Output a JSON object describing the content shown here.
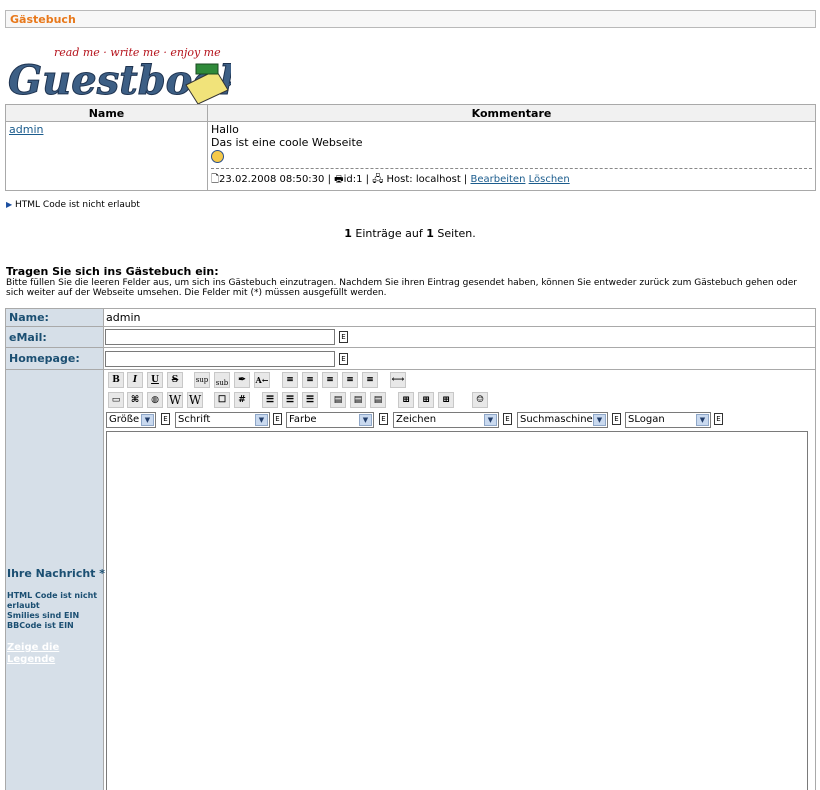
{
  "page_title": "Gästebuch",
  "logo": {
    "tagline": "read me · write me · enjoy me",
    "word": "Guestbook"
  },
  "table": {
    "col_name": "Name",
    "col_comments": "Kommentare",
    "entry": {
      "name": "admin",
      "line1": "Hallo",
      "line2": "Das ist eine coole Webseite",
      "meta_date": "23.02.2008 08:50:30",
      "meta_id": "id:1",
      "meta_host": "Host: localhost",
      "edit_link": "Bearbeiten",
      "delete_link": "Löschen"
    }
  },
  "html_notice": "HTML Code ist nicht erlaubt",
  "pagination": {
    "count": "1",
    "middle": " Einträge auf ",
    "pages": "1",
    "suffix": " Seiten."
  },
  "sign": {
    "title": "Tragen Sie sich ins Gästebuch ein:",
    "text": "Bitte füllen Sie die leeren Felder aus, um sich ins Gästebuch einzutragen. Nachdem Sie ihren Eintrag gesendet haben, können Sie entweder zurück zum Gästebuch gehen oder sich weiter auf der Webseite umsehen. Die Felder mit (*) müssen ausgefüllt werden."
  },
  "form": {
    "name_label": "Name:",
    "name_value": "admin",
    "email_label": "eMail:",
    "homepage_label": "Homepage:",
    "message_label": "Ihre Nachricht *:",
    "html_info": "HTML Code ist nicht erlaubt",
    "smilies_info": "Smilies sind EIN",
    "bbcode_info": "BBCode ist EIN",
    "legend_link": "Zeige die Legende"
  },
  "toolbar": {
    "row1": [
      "B",
      "I",
      "U",
      "S",
      "sup",
      "sub",
      "✒",
      "A←",
      "≡",
      "≡",
      "≡",
      "≡",
      "≡",
      "⟷"
    ],
    "row2": [
      "▭",
      "⌘",
      "◍",
      "W",
      "W",
      "☐",
      "#",
      "☰",
      "☰",
      "☰",
      "▤",
      "▤",
      "▤",
      "⊞",
      "⊞",
      "⊞",
      "☺"
    ],
    "selects": [
      "Größe",
      "Schrift",
      "Farbe",
      "Zeichen",
      "Suchmaschinen",
      "SLogan"
    ]
  },
  "colors": {
    "accent": "#e8781a",
    "label_bg": "#d6dfe8",
    "label_text": "#1b4f72",
    "link": "#1b5c8d"
  }
}
